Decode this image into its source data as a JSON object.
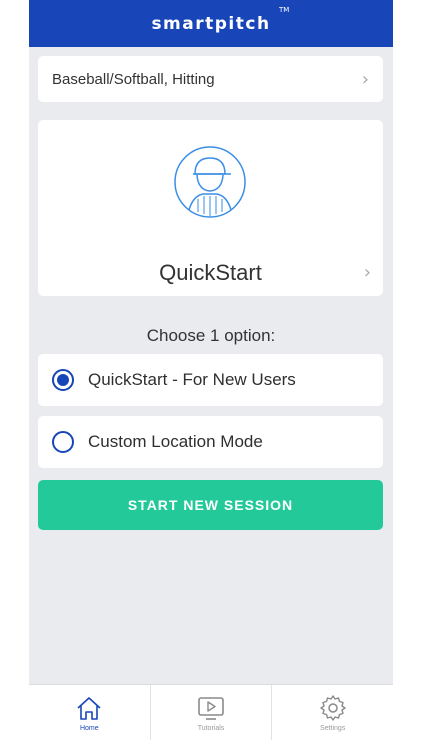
{
  "header": {
    "brand": "smartpitch",
    "trademark": "TM"
  },
  "sport_selector": {
    "label": "Baseball/Softball, Hitting",
    "chevron": "›"
  },
  "mode_card": {
    "title": "QuickStart",
    "chevron": "›",
    "icon": "batter-avatar-icon"
  },
  "choose_prompt": "Choose 1 option:",
  "options": [
    {
      "label": "QuickStart - For New Users",
      "selected": true
    },
    {
      "label": "Custom Location Mode",
      "selected": false
    }
  ],
  "start_button": {
    "label": "START NEW SESSION"
  },
  "tabbar": {
    "tabs": [
      {
        "label": "Home",
        "icon": "home-icon",
        "active": true
      },
      {
        "label": "Tutorials",
        "icon": "play-icon",
        "active": false
      },
      {
        "label": "Settings",
        "icon": "gear-icon",
        "active": false
      }
    ]
  },
  "colors": {
    "brand_blue": "#1846b8",
    "accent_green": "#24c99a",
    "background": "#e9ebef"
  }
}
